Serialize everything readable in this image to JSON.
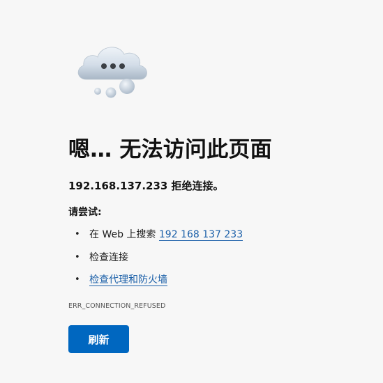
{
  "error": {
    "title": "嗯… 无法访问此页面",
    "message": "192.168.137.233 拒绝连接。",
    "try_heading": "请尝试:",
    "suggestions": {
      "search": {
        "prefix": "在 Web 上搜索 ",
        "link": "192 168 137 233"
      },
      "check_connection": "检查连接",
      "check_proxy": "检查代理和防火墙"
    },
    "code": "ERR_CONNECTION_REFUSED"
  },
  "actions": {
    "refresh_label": "刷新"
  },
  "icon": "cloud-error-icon",
  "colors": {
    "background": "#f7f7f7",
    "link": "#1a5fa8",
    "button": "#0067c0"
  }
}
